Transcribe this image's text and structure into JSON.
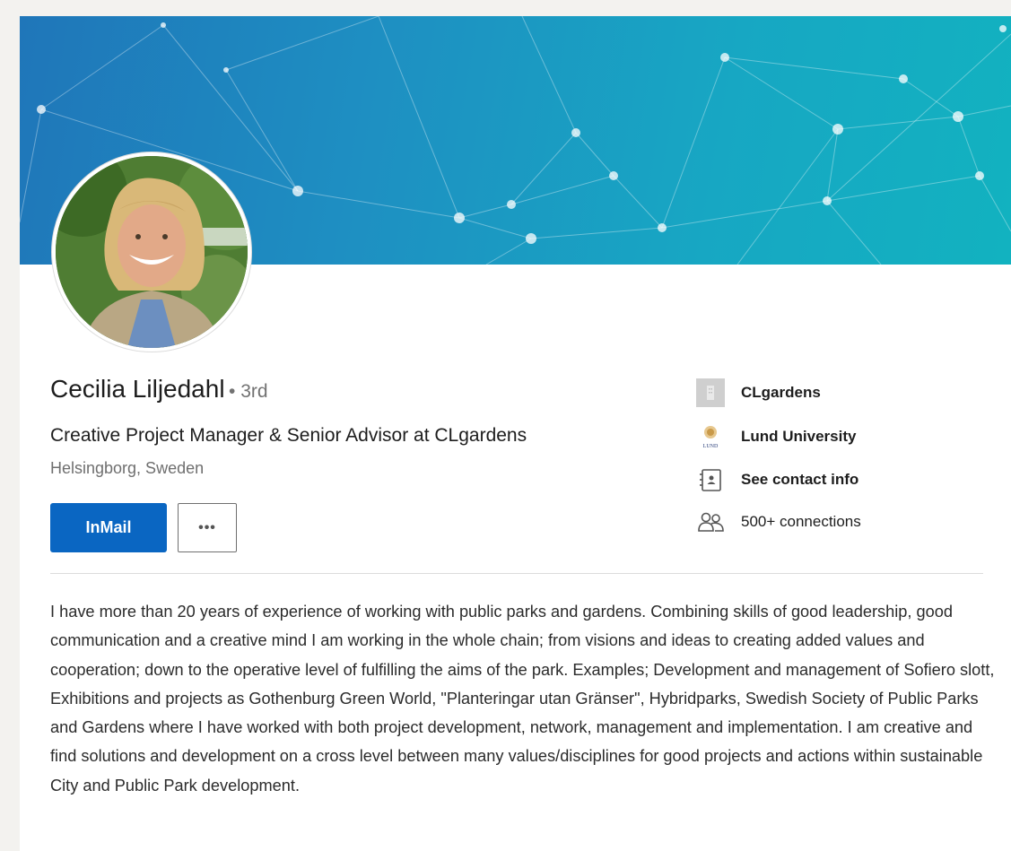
{
  "profile": {
    "name": "Cecilia Liljedahl",
    "degree": "• 3rd",
    "headline": "Creative Project Manager & Senior Advisor at CLgardens",
    "location": "Helsingborg, Sweden"
  },
  "actions": {
    "inmail_label": "InMail",
    "more_label": "•••"
  },
  "sidebar": {
    "company": "CLgardens",
    "school": "Lund University",
    "school_logo_text": "LUND",
    "contact": "See contact info",
    "connections": "500+ connections"
  },
  "about": {
    "text": "I have more than 20 years of experience of working with public parks and gardens. Combining skills of good leadership, good communication and a creative mind I am working in the whole chain; from visions and ideas to creating added values and cooperation; down to the operative level of fulfilling the aims of the park. Examples; Development and management of Sofiero slott, Exhibitions and projects as Gothenburg Green World, \"Planteringar utan Gränser\", Hybridparks, Swedish Society of Public Parks and Gardens where I have worked with both project development, network, management and implementation. I am creative and find solutions and development on a cross level between many values/disciplines for good projects and actions within sustainable City and Public Park development."
  },
  "colors": {
    "primary": "#0a66c2",
    "banner_start": "#1f76b9",
    "banner_end": "#12b2c0"
  }
}
